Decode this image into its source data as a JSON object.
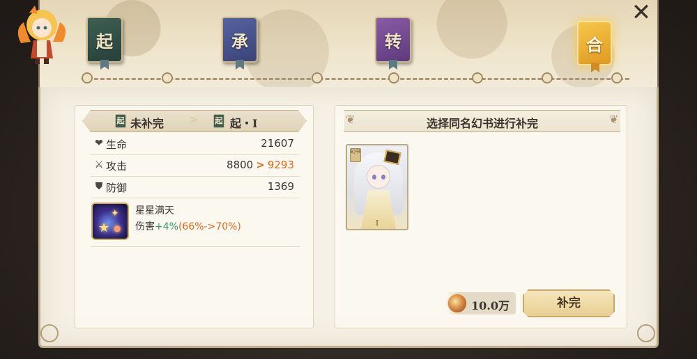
{
  "map": {
    "books": [
      {
        "glyph": "起",
        "state": "obtained",
        "color": "#3f5f52"
      },
      {
        "glyph": "承",
        "state": "obtained",
        "color": "#5663a0"
      },
      {
        "glyph": "转",
        "state": "obtained",
        "color": "#8a5ba6"
      },
      {
        "glyph": "合",
        "state": "selected",
        "color": "#f2b23a"
      }
    ]
  },
  "close": {
    "icon": "close-icon"
  },
  "upgrade": {
    "from_label": "未补完",
    "from_book_glyph": "起",
    "arrow": ">",
    "to_book_glyph": "起",
    "to_label": "起・I"
  },
  "stats": [
    {
      "icon": "heart-icon",
      "label": "生命",
      "value": "21607",
      "new_value": ""
    },
    {
      "icon": "sword-icon",
      "label": "攻击",
      "value": "8800",
      "arrow": ">",
      "new_value": "9293"
    },
    {
      "icon": "shield-icon",
      "label": "防御",
      "value": "1369",
      "new_value": ""
    }
  ],
  "skill": {
    "name": "星星满天",
    "desc_prefix": "伤害",
    "desc_plus": "+4%",
    "desc_range": "(66%->70%)"
  },
  "select_panel": {
    "title": "选择同名幻书进行补完",
    "card": {
      "badge": "幻书",
      "level": "I"
    }
  },
  "cost": {
    "amount": "10.0万",
    "icon": "coin-icon"
  },
  "fill_button": {
    "label": "补完"
  },
  "colors": {
    "increase": "#e2661a",
    "bonus": "#2e9a6a",
    "parchment": "#f6f1e6"
  }
}
